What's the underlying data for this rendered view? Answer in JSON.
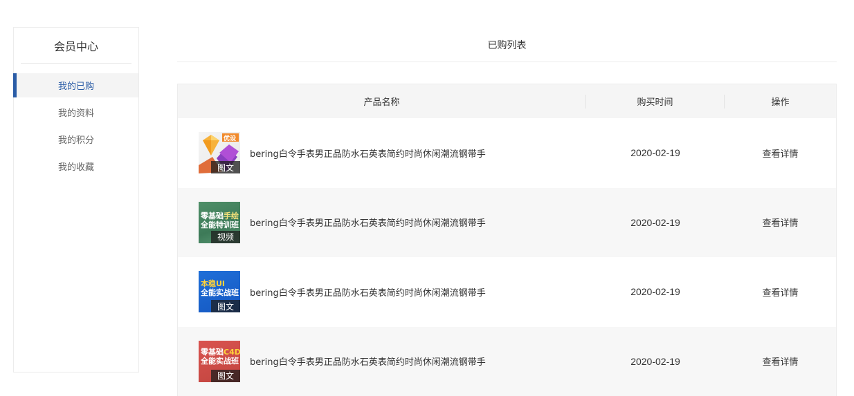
{
  "sidebar": {
    "title": "会员中心",
    "items": [
      {
        "label": "我的已购",
        "active": true
      },
      {
        "label": "我的资料",
        "active": false
      },
      {
        "label": "我的积分",
        "active": false
      },
      {
        "label": "我的收藏",
        "active": false
      }
    ]
  },
  "main": {
    "title": "已购列表",
    "table": {
      "headers": {
        "name": "产品名称",
        "time": "购买时间",
        "action": "操作"
      },
      "rows": [
        {
          "name": "bering白令手表男正品防水石英表简约时尚休闲潮流钢带手",
          "time": "2020-02-19",
          "action": "查看详情",
          "tag": "图文",
          "thumb_text": "",
          "thumb_icon": "sketch-diamond-icon"
        },
        {
          "name": "bering白令手表男正品防水石英表简约时尚休闲潮流钢带手",
          "time": "2020-02-19",
          "action": "查看详情",
          "tag": "视频",
          "thumb_text": "零基础手绘\n全能特训班",
          "thumb_icon": ""
        },
        {
          "name": "bering白令手表男正品防水石英表简约时尚休闲潮流钢带手",
          "time": "2020-02-19",
          "action": "查看详情",
          "tag": "图文",
          "thumb_text": "本稳UI\n全能实战班",
          "thumb_icon": ""
        },
        {
          "name": "bering白令手表男正品防水石英表简约时尚休闲潮流钢带手",
          "time": "2020-02-19",
          "action": "查看详情",
          "tag": "图文",
          "thumb_text": "零基础C4D\n全能实战班",
          "thumb_icon": ""
        }
      ]
    }
  },
  "colors": {
    "accent": "#2a5ca6",
    "header_bg": "#f5f5f5",
    "row_alt_bg": "#f7f7f7"
  }
}
